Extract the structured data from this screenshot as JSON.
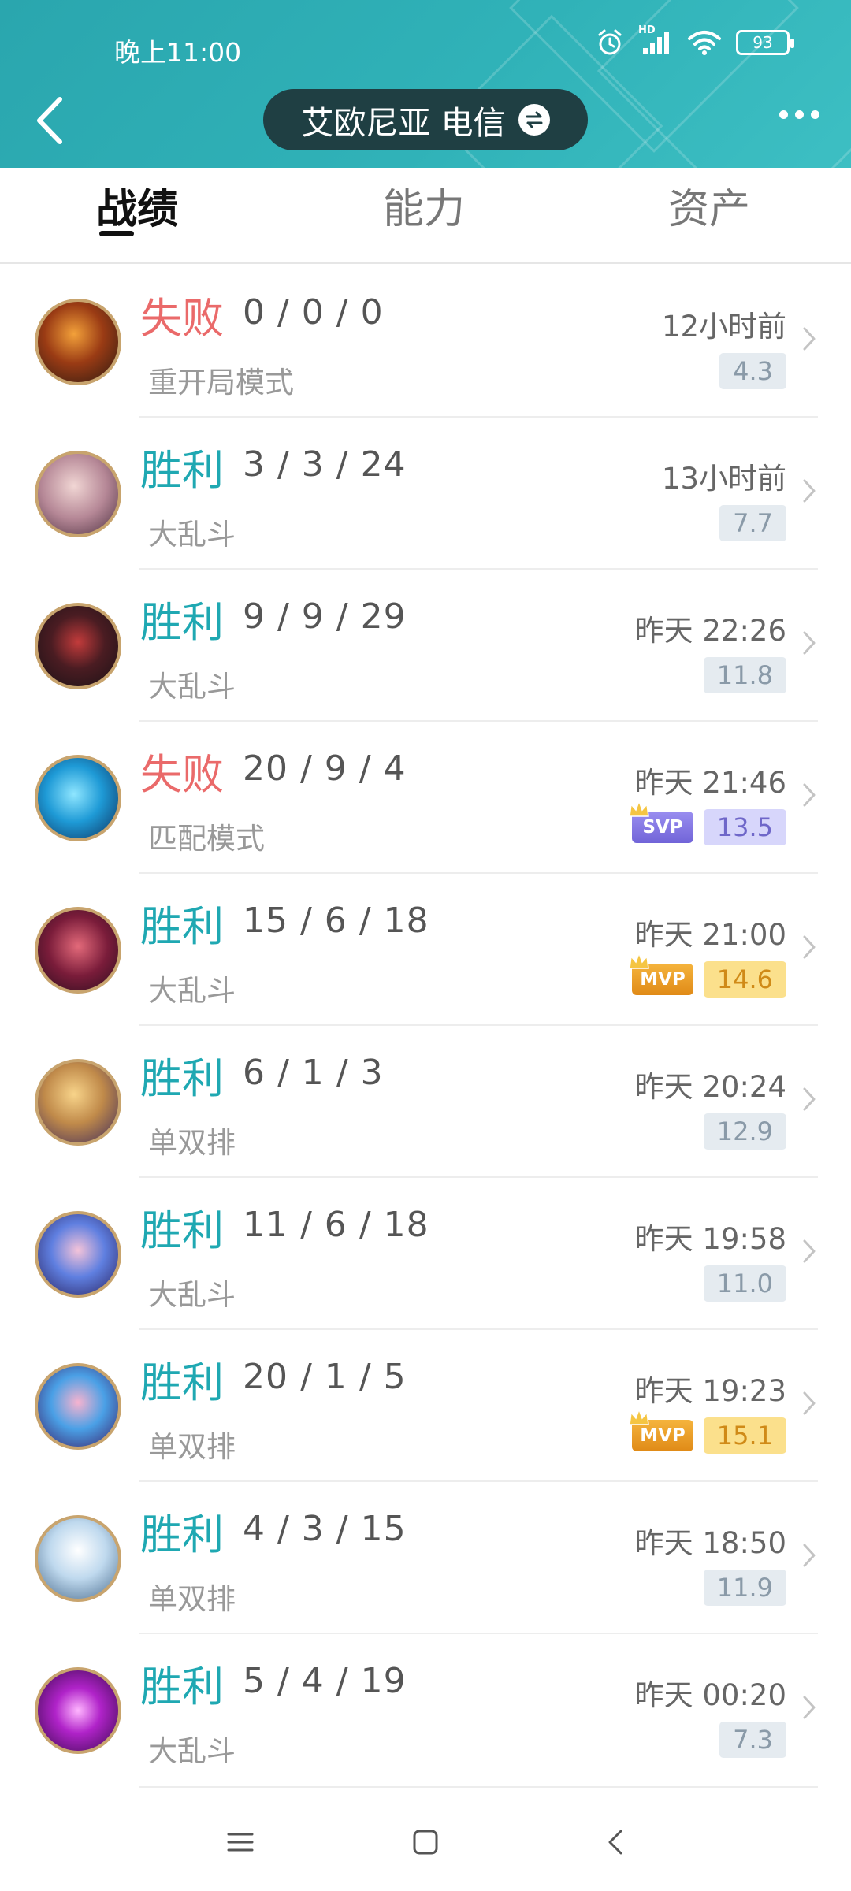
{
  "status_bar": {
    "time": "晚上11:00",
    "battery": "93",
    "network": "HD"
  },
  "header": {
    "server": "艾欧尼亚 电信"
  },
  "tabs": [
    {
      "label": "战绩"
    },
    {
      "label": "能力"
    },
    {
      "label": "资产"
    }
  ],
  "colors": {
    "accent": "#2fb0b7",
    "win": "#1fa8b2",
    "loss": "#ea6a6a",
    "pill": "#1f3f43"
  },
  "matches": [
    {
      "result": "失败",
      "kda": "0 / 0 / 0",
      "mode": "重开局模式",
      "time": "12小时前",
      "score": "4.3",
      "badge": ""
    },
    {
      "result": "胜利",
      "kda": "3 / 3 / 24",
      "mode": "大乱斗",
      "time": "13小时前",
      "score": "7.7",
      "badge": ""
    },
    {
      "result": "胜利",
      "kda": "9 / 9 / 29",
      "mode": "大乱斗",
      "time": "昨天 22:26",
      "score": "11.8",
      "badge": ""
    },
    {
      "result": "失败",
      "kda": "20 / 9 / 4",
      "mode": "匹配模式",
      "time": "昨天 21:46",
      "score": "13.5",
      "badge": "SVP"
    },
    {
      "result": "胜利",
      "kda": "15 / 6 / 18",
      "mode": "大乱斗",
      "time": "昨天 21:00",
      "score": "14.6",
      "badge": "MVP"
    },
    {
      "result": "胜利",
      "kda": "6 / 1 / 3",
      "mode": "单双排",
      "time": "昨天 20:24",
      "score": "12.9",
      "badge": ""
    },
    {
      "result": "胜利",
      "kda": "11 / 6 / 18",
      "mode": "大乱斗",
      "time": "昨天 19:58",
      "score": "11.0",
      "badge": ""
    },
    {
      "result": "胜利",
      "kda": "20 / 1 / 5",
      "mode": "单双排",
      "time": "昨天 19:23",
      "score": "15.1",
      "badge": "MVP"
    },
    {
      "result": "胜利",
      "kda": "4 / 3 / 15",
      "mode": "单双排",
      "time": "昨天 18:50",
      "score": "11.9",
      "badge": ""
    },
    {
      "result": "胜利",
      "kda": "5 / 4 / 19",
      "mode": "大乱斗",
      "time": "昨天 00:20",
      "score": "7.3",
      "badge": ""
    }
  ]
}
